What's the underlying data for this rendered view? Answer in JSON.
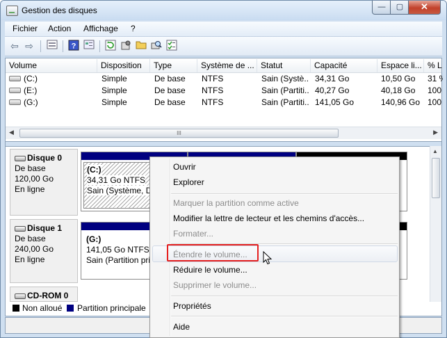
{
  "window": {
    "title": "Gestion des disques",
    "controls": [
      "—",
      "▢",
      "✕"
    ]
  },
  "menu": [
    "Fichier",
    "Action",
    "Affichage",
    "?"
  ],
  "toolbar_icons": [
    "back-arrow-icon",
    "forward-arrow-icon",
    "list-view-icon",
    "help-icon",
    "properties-icon",
    "refresh-icon",
    "settings-icon",
    "open-folder-icon",
    "search-disk-icon",
    "checklist-icon"
  ],
  "list": {
    "columns": [
      "Volume",
      "Disposition",
      "Type",
      "Système de ...",
      "Statut",
      "Capacité",
      "Espace li...",
      "% L"
    ],
    "rows": [
      [
        "(C:)",
        "Simple",
        "De base",
        "NTFS",
        "Sain (Systè...",
        "34,31 Go",
        "10,50 Go",
        "31 %"
      ],
      [
        "(E:)",
        "Simple",
        "De base",
        "NTFS",
        "Sain (Partiti...",
        "40,27 Go",
        "40,18 Go",
        "100"
      ],
      [
        "(G:)",
        "Simple",
        "De base",
        "NTFS",
        "Sain (Partiti...",
        "141,05 Go",
        "140,96 Go",
        "100"
      ]
    ]
  },
  "scroll_thumb_label": "III",
  "disks": [
    {
      "name": "Disque 0",
      "type": "De base",
      "size": "120,00 Go",
      "status": "En ligne",
      "partition": {
        "name": "(C:)",
        "size": "34,31 Go NTFS",
        "status": "Sain (Système, Dé"
      }
    },
    {
      "name": "Disque 1",
      "type": "De base",
      "size": "240,00 Go",
      "status": "En ligne",
      "partition": {
        "name": "(G:)",
        "size": "141,05 Go NTFS",
        "status": "Sain (Partition pri"
      }
    },
    {
      "name": "CD-ROM 0"
    }
  ],
  "legend": [
    {
      "label": "Non alloué",
      "color": "#000000"
    },
    {
      "label": "Partition principale",
      "color": "#000080"
    }
  ],
  "context_menu": {
    "items": [
      {
        "label": "Ouvrir",
        "enabled": true
      },
      {
        "label": "Explorer",
        "enabled": true
      },
      {
        "label": "Marquer la partition comme active",
        "enabled": false
      },
      {
        "label": "Modifier la lettre de lecteur et les chemins d'accès...",
        "enabled": true
      },
      {
        "label": "Formater...",
        "enabled": false
      },
      {
        "label": "Étendre le volume...",
        "enabled": false,
        "highlighted": true
      },
      {
        "label": "Réduire le volume...",
        "enabled": true
      },
      {
        "label": "Supprimer le volume...",
        "enabled": false
      },
      {
        "label": "Propriétés",
        "enabled": true
      },
      {
        "label": "Aide",
        "enabled": true
      }
    ]
  },
  "colors": {
    "primary_partition": "#000080",
    "unallocated": "#000000",
    "highlight_box": "#e52020"
  }
}
